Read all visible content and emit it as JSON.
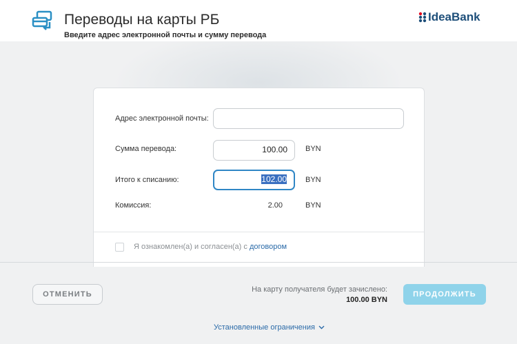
{
  "header": {
    "title": "Переводы на карты РБ",
    "subtitle": "Введите адрес электронной почты и сумму перевода",
    "brand": "IdeaBank"
  },
  "form": {
    "email_label": "Адрес электронной почты:",
    "email_value": "",
    "amount_label": "Сумма перевода:",
    "amount_value": "100.00",
    "amount_currency": "BYN",
    "total_label": "Итого к списанию:",
    "total_value": "102.00",
    "total_currency": "BYN",
    "fee_label": "Комиссия:",
    "fee_value": "2.00",
    "fee_currency": "BYN"
  },
  "agreement": {
    "text": "Я ознакомлен(а) и согласен(а) с",
    "link": "договором",
    "checked": false
  },
  "footer": {
    "cancel_label": "ОТМЕНИТЬ",
    "credit_label": "На карту получателя будет зачислено:",
    "credit_amount": "100.00 BYN",
    "continue_label": "ПРОДОЛЖИТЬ",
    "limits_link": "Установленные ограничения"
  },
  "colors": {
    "accent": "#2f86c5",
    "link": "#2a6aa8",
    "continue_button": "#8fd3ea",
    "brand": "#1e4f7a"
  },
  "icons": [
    "transfer-cards-icon",
    "chevron-down-icon"
  ]
}
